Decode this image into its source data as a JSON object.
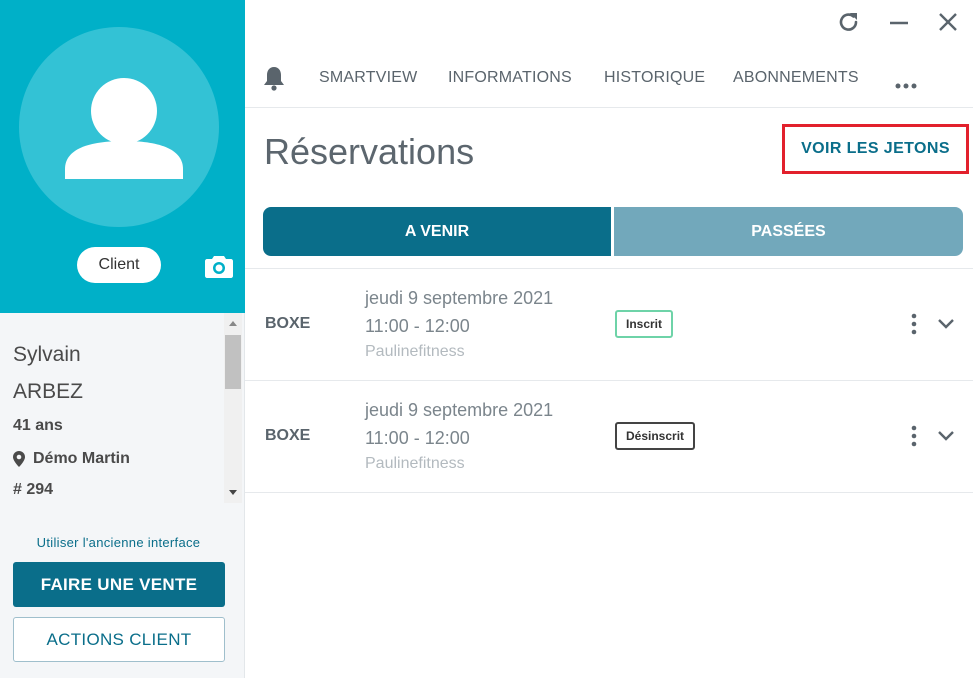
{
  "sidebar": {
    "role_label": "Client",
    "first_name": "Sylvain",
    "last_name": "ARBEZ",
    "age": "41 ans",
    "location": "Démo Martin",
    "member_number": "# 294",
    "old_interface_link": "Utiliser l'ancienne interface",
    "sale_button": "FAIRE UNE VENTE",
    "actions_button": "ACTIONS CLIENT"
  },
  "nav": {
    "items": [
      "SMARTVIEW",
      "INFORMATIONS",
      "HISTORIQUE",
      "ABONNEMENTS"
    ]
  },
  "main": {
    "title": "Réservations",
    "tokens_button": "VOIR LES JETONS",
    "tabs": [
      {
        "label": "A VENIR",
        "active": true
      },
      {
        "label": "PASSÉES",
        "active": false
      }
    ],
    "reservations": [
      {
        "activity": "BOXE",
        "date": "jeudi 9 septembre 2021",
        "time": "11:00 - 12:00",
        "coach": "Paulinefitness",
        "status": "Inscrit"
      },
      {
        "activity": "BOXE",
        "date": "jeudi 9 septembre 2021",
        "time": "11:00 - 12:00",
        "coach": "Paulinefitness",
        "status": "Désinscrit"
      }
    ]
  },
  "colors": {
    "brand_teal": "#00b0c8",
    "primary": "#0a6e8a",
    "tab_inactive": "#72a8bb",
    "highlight_red": "#e2202c",
    "status_registered": "#6ed3a8"
  }
}
